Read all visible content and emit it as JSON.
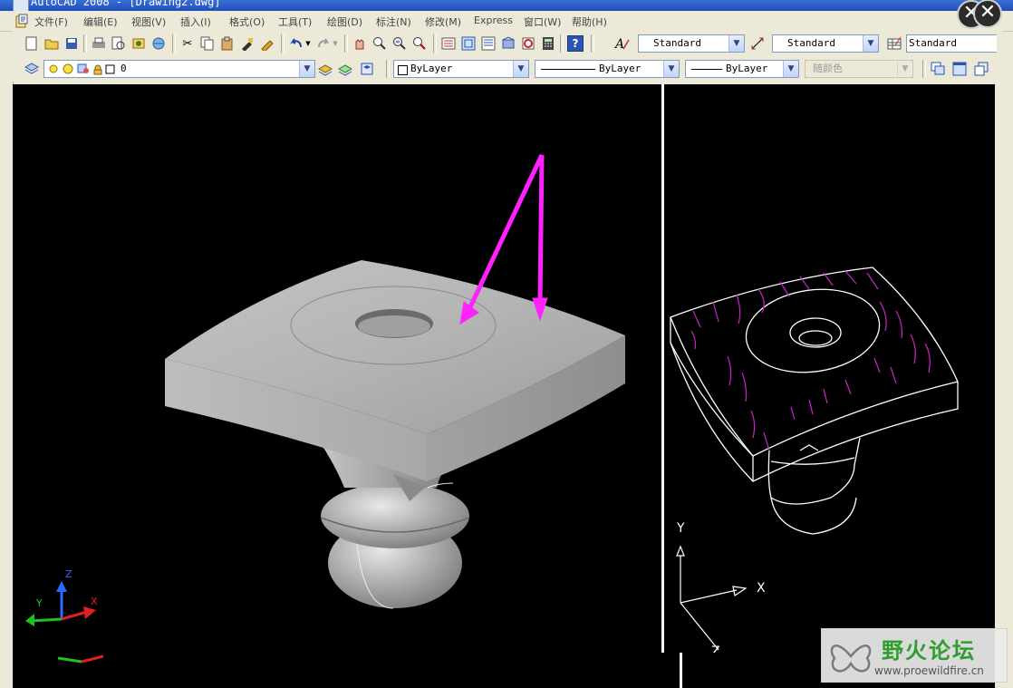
{
  "window": {
    "title": "AutoCAD 2008 - [Drawing2.dwg]"
  },
  "menu": [
    "文件(F)",
    "编辑(E)",
    "视图(V)",
    "插入(I)",
    "格式(O)",
    "工具(T)",
    "绘图(D)",
    "标注(N)",
    "修改(M)",
    "Express",
    "窗口(W)",
    "帮助(H)"
  ],
  "toolbar_styles": {
    "text_style": "Standard",
    "dim_style": "Standard",
    "table_style": "Standard"
  },
  "layer": {
    "current": "0"
  },
  "properties": {
    "color": "ByLayer",
    "linetype": "ByLayer",
    "lineweight": "ByLayer",
    "plot_style": "随颜色"
  },
  "ucs_left": {
    "x": "X",
    "y": "Y",
    "z": "Z"
  },
  "ucs_right": {
    "x": "X",
    "y": "Y",
    "z": "Z"
  },
  "watermark": {
    "name": "野火论坛",
    "url": "www.proewildfire.cn"
  },
  "colors": {
    "annotation_arrow": "#ff22ff",
    "viewport_bg": "#000000",
    "hatch": "#cc22cc"
  }
}
